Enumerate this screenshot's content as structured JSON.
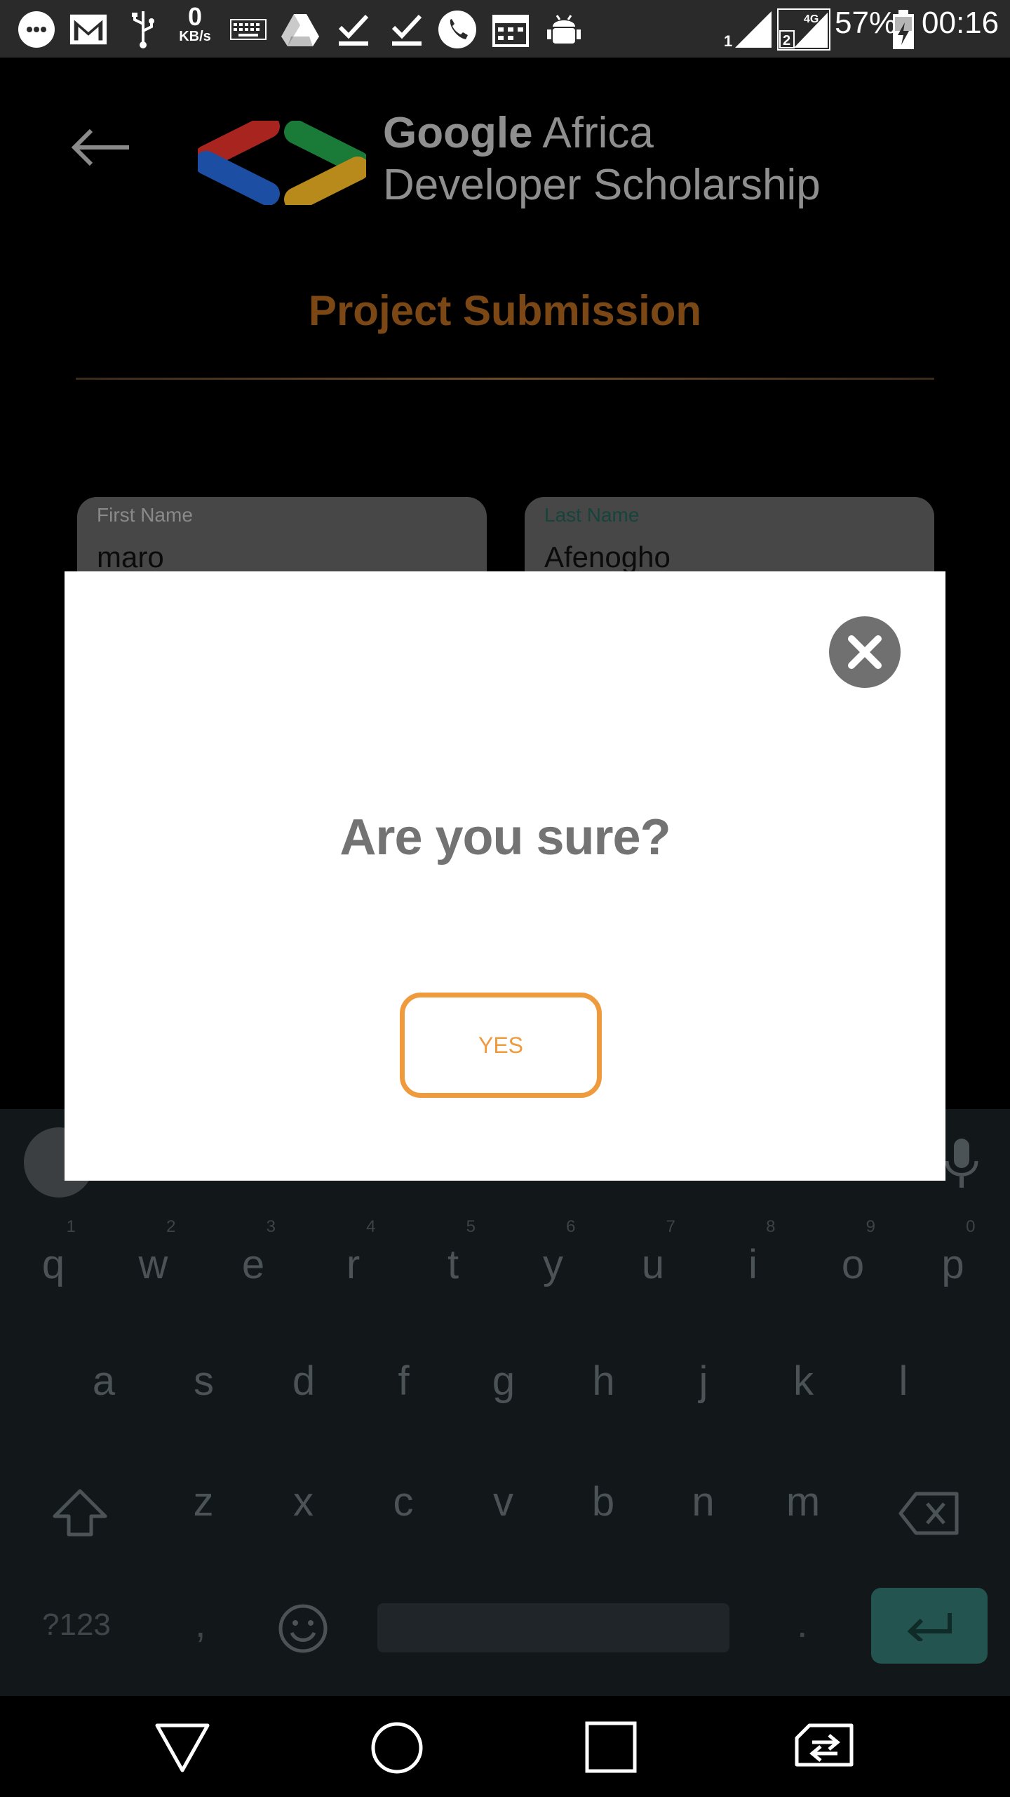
{
  "status_bar": {
    "speed_value": "0",
    "speed_unit": "KB/s",
    "battery": "57%",
    "time": "00:16",
    "sim1": "1",
    "sim2": "2",
    "network": "4G",
    "icons": [
      "messenger-icon",
      "gmail-icon",
      "usb-icon",
      "keyboard-icon",
      "drive-icon",
      "check-icon",
      "check-icon",
      "phone-icon",
      "calendar-icon",
      "android-debug-icon",
      "signal-icon",
      "battery-charging-icon"
    ]
  },
  "header": {
    "brand_bold": "Google",
    "brand_rest": " Africa",
    "brand_line2": "Developer Scholarship",
    "page_title": "Project Submission"
  },
  "form": {
    "first_name_label": "First Name",
    "first_name_value": "maro",
    "last_name_label": "Last Name",
    "last_name_value": "Afenogho"
  },
  "dialog": {
    "title": "Are you sure?",
    "confirm_label": "YES"
  },
  "keyboard": {
    "row1": [
      {
        "k": "q",
        "h": "1"
      },
      {
        "k": "w",
        "h": "2"
      },
      {
        "k": "e",
        "h": "3"
      },
      {
        "k": "r",
        "h": "4"
      },
      {
        "k": "t",
        "h": "5"
      },
      {
        "k": "y",
        "h": "6"
      },
      {
        "k": "u",
        "h": "7"
      },
      {
        "k": "i",
        "h": "8"
      },
      {
        "k": "o",
        "h": "9"
      },
      {
        "k": "p",
        "h": "0"
      }
    ],
    "row2": [
      "a",
      "s",
      "d",
      "f",
      "g",
      "h",
      "j",
      "k",
      "l"
    ],
    "row3": [
      "z",
      "x",
      "c",
      "v",
      "b",
      "n",
      "m"
    ],
    "symbols_label": "?123",
    "comma": ",",
    "period": "."
  },
  "colors": {
    "accent": "#f09a3e",
    "title_dim": "#7a4715",
    "first_label": "#8a8a8a",
    "last_label": "#16443b",
    "enter_key": "#24544f"
  }
}
